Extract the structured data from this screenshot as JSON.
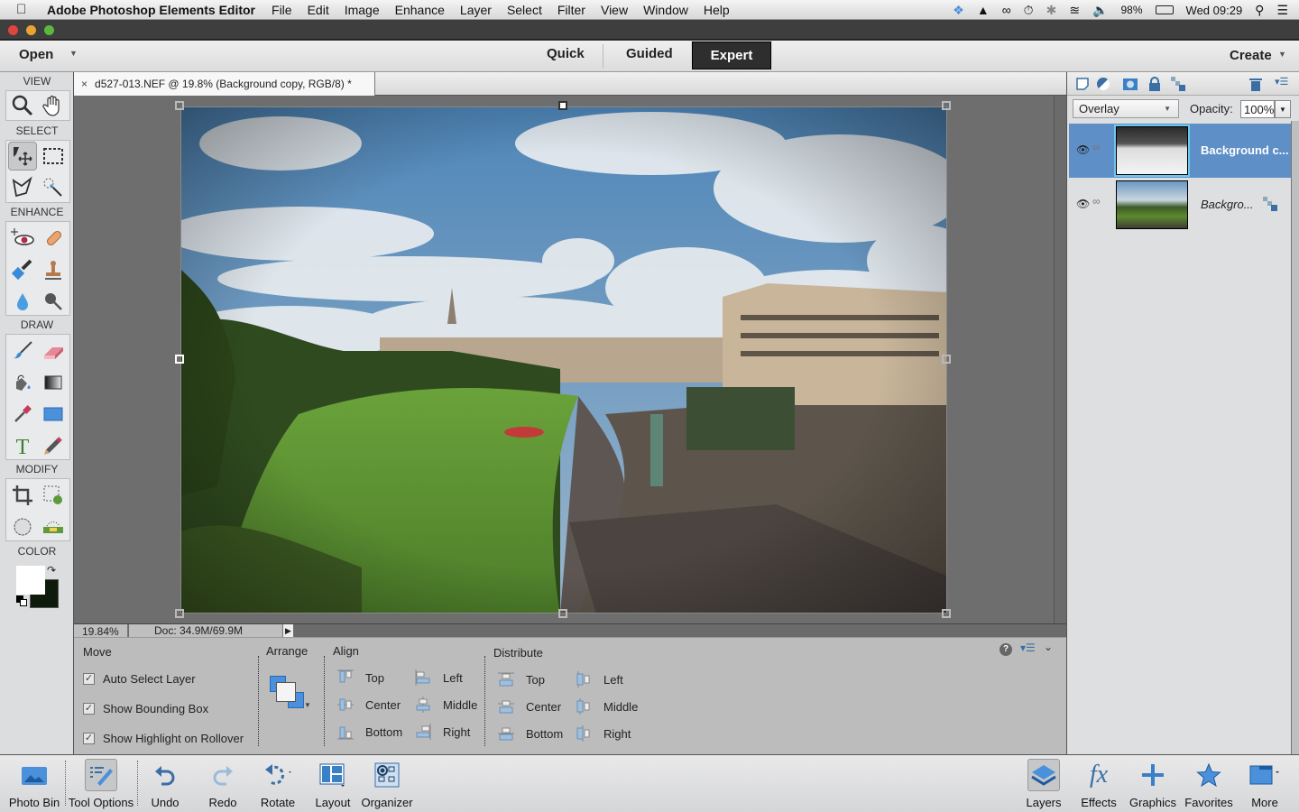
{
  "menubar": {
    "app_name": "Adobe Photoshop Elements Editor",
    "menus": [
      "File",
      "Edit",
      "Image",
      "Enhance",
      "Layer",
      "Select",
      "Filter",
      "View",
      "Window",
      "Help"
    ],
    "battery": "98%",
    "clock": "Wed 09:29"
  },
  "modebar": {
    "open_label": "Open",
    "modes": [
      "Quick",
      "Guided",
      "Expert"
    ],
    "active_mode": "Expert",
    "create_label": "Create"
  },
  "toolbox": {
    "sections": [
      "VIEW",
      "SELECT",
      "ENHANCE",
      "DRAW",
      "MODIFY",
      "COLOR"
    ],
    "foreground_color": "#ffffff",
    "background_color": "#0e1a0b"
  },
  "document": {
    "tab_title": "d527-013.NEF @ 19.8% (Background copy, RGB/8) *",
    "close_glyph": "×",
    "zoom": "19.84%",
    "doc_size": "Doc: 34.9M/69.9M"
  },
  "tool_options": {
    "move": {
      "title": "Move",
      "options": [
        {
          "label": "Auto Select Layer",
          "checked": true
        },
        {
          "label": "Show Bounding Box",
          "checked": true
        },
        {
          "label": "Show Highlight on Rollover",
          "checked": true
        }
      ]
    },
    "arrange": {
      "title": "Arrange"
    },
    "align": {
      "title": "Align",
      "col1": [
        "Top",
        "Center",
        "Bottom"
      ],
      "col2": [
        "Left",
        "Middle",
        "Right"
      ]
    },
    "distribute": {
      "title": "Distribute",
      "col1": [
        "Top",
        "Center",
        "Bottom"
      ],
      "col2": [
        "Left",
        "Middle",
        "Right"
      ]
    }
  },
  "layers_panel": {
    "blend_mode": "Overlay",
    "opacity_label": "Opacity:",
    "opacity": "100%",
    "layers": [
      {
        "name": "Background c...",
        "active": true
      },
      {
        "name": "Backgro...",
        "active": false,
        "locked": true
      }
    ]
  },
  "bottombar": {
    "left": [
      "Photo Bin",
      "Tool Options",
      "Undo",
      "Redo",
      "Rotate",
      "Layout",
      "Organizer"
    ],
    "right": [
      "Layers",
      "Effects",
      "Graphics",
      "Favorites",
      "More"
    ]
  }
}
